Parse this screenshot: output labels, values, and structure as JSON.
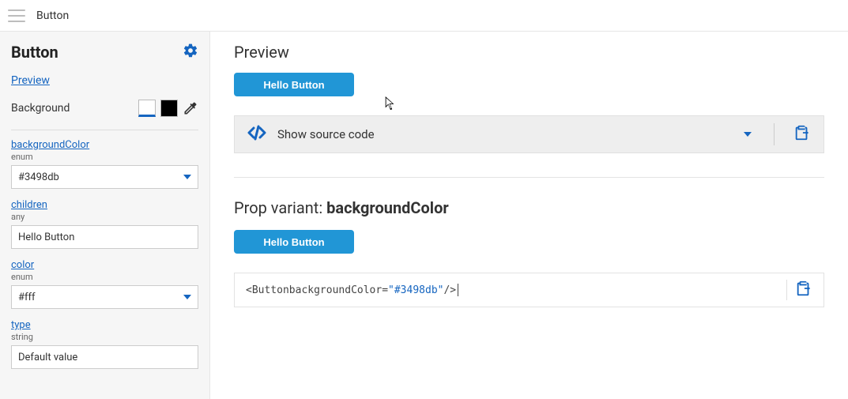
{
  "topbar": {
    "title": "Button"
  },
  "sidebar": {
    "title": "Button",
    "preview_link": "Preview",
    "background_label": "Background",
    "props": {
      "backgroundColor": {
        "name": "backgroundColor",
        "type": "enum",
        "value": "#3498db"
      },
      "children": {
        "name": "children",
        "type": "any",
        "value": "Hello Button"
      },
      "color": {
        "name": "color",
        "type": "enum",
        "value": "#fff"
      },
      "ptype": {
        "name": "type",
        "type": "string",
        "value": "Default value"
      }
    }
  },
  "content": {
    "preview_header": "Preview",
    "preview_button_label": "Hello Button",
    "source_bar_label": "Show source code",
    "variant_prefix": "Prop variant: ",
    "variant_name": "backgroundColor",
    "variant_button_label": "Hello Button",
    "code": {
      "tag_open": "<Button ",
      "attr": "backgroundColor",
      "eq": "=",
      "val": "\"#3498db\"",
      "tag_close": " />"
    }
  }
}
